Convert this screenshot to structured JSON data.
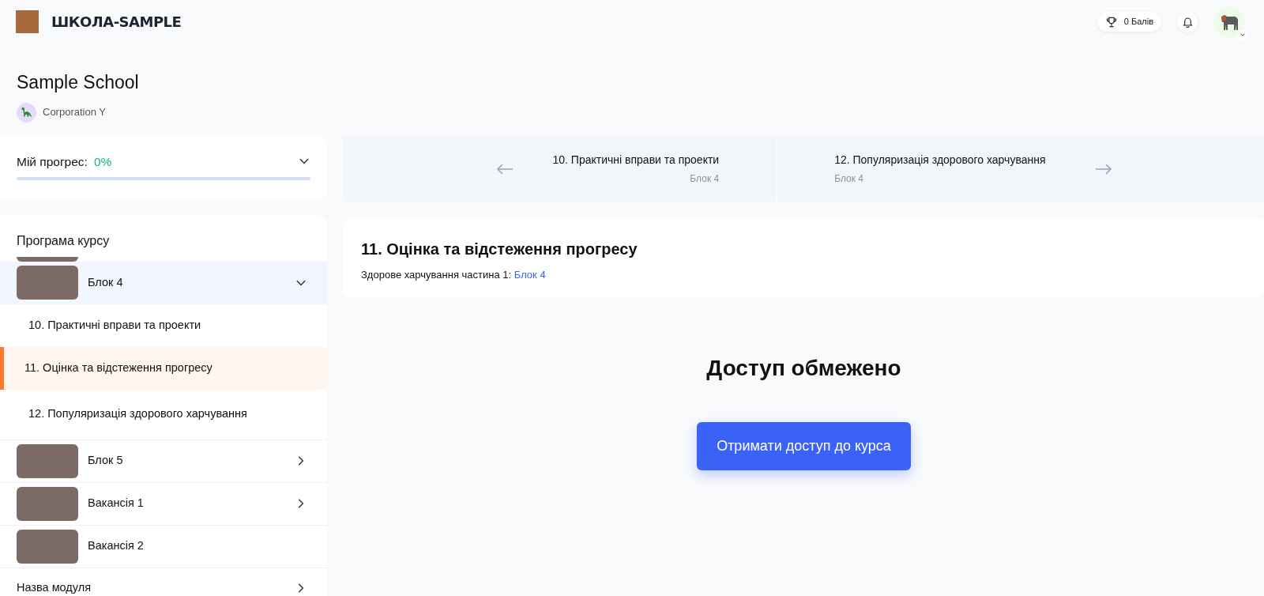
{
  "header": {
    "brand": "ШКОЛА-SAMPLE",
    "points": "0 Балів"
  },
  "school": {
    "name": "Sample School",
    "organization": "Corporation Y"
  },
  "progress": {
    "label": "Мій прогрес:",
    "value": "0%",
    "level": 0,
    "expanded": false
  },
  "program": {
    "title": "Програма курсу",
    "modules": [
      {
        "title": "Блок 4",
        "kind": "thumbnail",
        "has_children": true,
        "expanded": true,
        "lessons": [
          {
            "title": "10. Практичні вправи та проекти",
            "selected": false
          },
          {
            "title": "11. Оцінка та відстеження прогресу",
            "selected": true
          },
          {
            "title": "12. Популяризація здорового харчування",
            "selected": false
          }
        ]
      },
      {
        "title": "Блок 5",
        "kind": "thumbnail",
        "has_children": true,
        "expanded": false
      },
      {
        "title": "Вакансія 1",
        "kind": "thumbnail",
        "has_children": true,
        "expanded": false
      },
      {
        "title": "Вакансія 2",
        "kind": "thumbnail",
        "has_children": false,
        "expanded": false
      },
      {
        "title": "Назва модуля",
        "kind": "plain",
        "has_children": true,
        "expanded": false
      }
    ]
  },
  "navigation": {
    "previous": {
      "title": "10. Практичні вправи та проекти",
      "block": "Блок 4"
    },
    "next": {
      "title": "12. Популяризація здорового харчування",
      "block": "Блок 4"
    }
  },
  "lesson": {
    "title": "11. Оцінка та відстеження прогресу",
    "context": "Здорове харчування частина 1:",
    "link": "Блок 4"
  },
  "access": {
    "title": "Доступ обмежено",
    "button": "Отримати доступ до курса"
  }
}
